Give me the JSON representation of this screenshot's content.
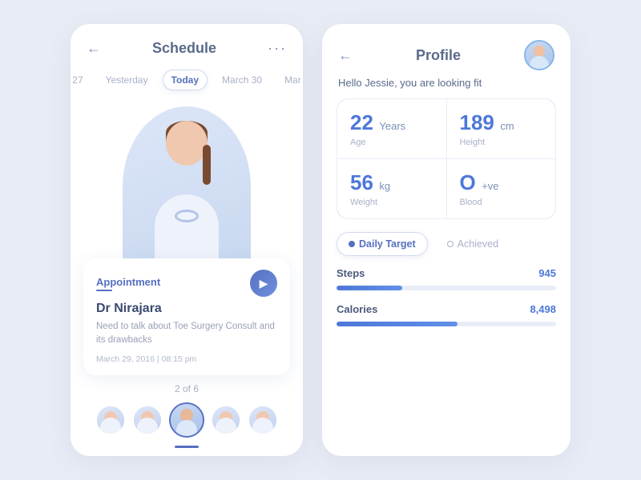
{
  "schedule": {
    "title": "Schedule",
    "back_arrow": "←",
    "more": "···",
    "dates": [
      {
        "label": "27",
        "active": false
      },
      {
        "label": "Yesterday",
        "active": false
      },
      {
        "label": "Today",
        "active": true
      },
      {
        "label": "March 30",
        "active": false
      },
      {
        "label": "Mar",
        "active": false
      }
    ],
    "appointment": {
      "label": "Appointment",
      "doctor_name": "Dr Nirajara",
      "description": "Need to talk about Toe Surgery Consult and its drawbacks",
      "datetime": "March 29, 2016  |  08:15 pm",
      "icon": "▶"
    },
    "pagination": "2 of 6",
    "avatars": [
      {
        "id": 1,
        "active": false
      },
      {
        "id": 2,
        "active": false
      },
      {
        "id": 3,
        "active": true
      },
      {
        "id": 4,
        "active": false
      },
      {
        "id": 5,
        "active": false
      }
    ]
  },
  "profile": {
    "title": "Profile",
    "back_arrow": "←",
    "greeting": "Hello Jessie, you are looking fit",
    "stats": [
      {
        "value": "22",
        "unit": "Years",
        "label": "Age"
      },
      {
        "value": "189",
        "unit": "cm",
        "label": "Height"
      },
      {
        "value": "56",
        "unit": "kg",
        "label": "Weight"
      },
      {
        "value": "O",
        "unit": "+ve",
        "label": "Blood"
      }
    ],
    "tabs": [
      {
        "label": "Daily Target",
        "active": true
      },
      {
        "label": "Achieved",
        "active": false
      }
    ],
    "metrics": [
      {
        "label": "Steps",
        "value": "945",
        "percent": 30
      },
      {
        "label": "Calories",
        "value": "8,498",
        "percent": 55
      }
    ]
  }
}
